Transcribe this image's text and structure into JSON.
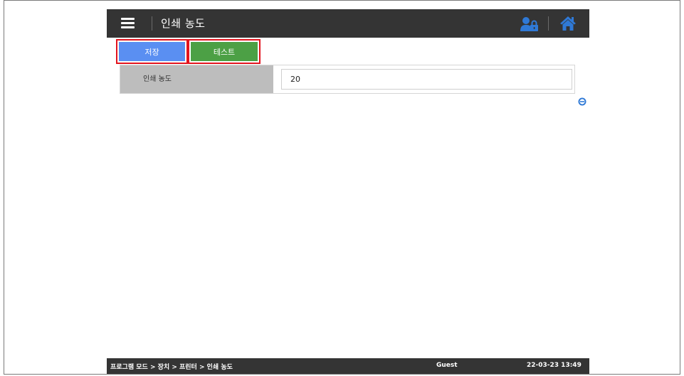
{
  "header": {
    "title": "인쇄 농도",
    "menu_icon": "hamburger-menu-icon",
    "user_icon": "user-lock-icon",
    "home_icon": "home-icon"
  },
  "toolbar": {
    "save_label": "저장",
    "test_label": "테스트"
  },
  "setting": {
    "label": "인쇄 농도",
    "value": "20"
  },
  "side_toggle_icon": "minus-circle-icon",
  "footer": {
    "breadcrumb": "프로그램 모드 > 장치 > 프린터 > 인쇄 농도",
    "user": "Guest",
    "datetime": "22-03-23 13:49"
  },
  "colors": {
    "header_bg": "#343434",
    "save_button": "#5a8ff2",
    "test_button": "#4ca045",
    "highlight_border": "#e2141e",
    "icon_blue": "#2f79d6"
  }
}
